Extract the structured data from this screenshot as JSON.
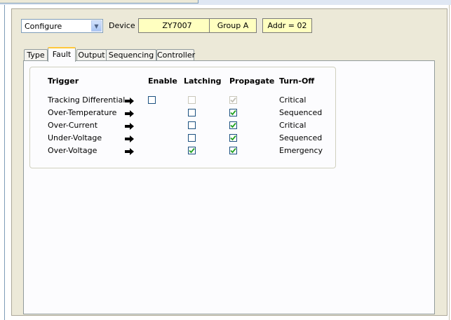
{
  "header": {
    "mode_select": {
      "value": "Configure"
    },
    "device_label": "Device",
    "device": "ZY7007",
    "group": "Group A",
    "address": "Addr = 02"
  },
  "tabs": [
    {
      "label": "Type",
      "active": false
    },
    {
      "label": "Fault",
      "active": true
    },
    {
      "label": "Output",
      "active": false
    },
    {
      "label": "Sequencing",
      "active": false
    },
    {
      "label": "Controller",
      "active": false
    }
  ],
  "fault_table": {
    "headers": {
      "trigger": "Trigger",
      "enable": "Enable",
      "latching": "Latching",
      "propagate": "Propagate",
      "turn_off": "Turn-Off"
    },
    "rows": [
      {
        "trigger": "Tracking Differential",
        "enable": false,
        "latching": false,
        "latching_disabled": true,
        "propagate": true,
        "propagate_disabled": true,
        "turn_off": "Critical"
      },
      {
        "trigger": "Over-Temperature",
        "latching": false,
        "propagate": true,
        "turn_off": "Sequenced"
      },
      {
        "trigger": "Over-Current",
        "latching": false,
        "propagate": true,
        "turn_off": "Critical"
      },
      {
        "trigger": "Under-Voltage",
        "latching": false,
        "propagate": true,
        "turn_off": "Sequenced"
      },
      {
        "trigger": "Over-Voltage",
        "latching": true,
        "propagate": true,
        "turn_off": "Emergency"
      }
    ]
  },
  "colors": {
    "info_bg": "#ffffc0",
    "check_mark": "#21a121",
    "active_tab_accent": "#ffc83c"
  },
  "icons": {
    "arrow": "arrow-right-icon",
    "dropdown": "chevron-down-icon"
  }
}
